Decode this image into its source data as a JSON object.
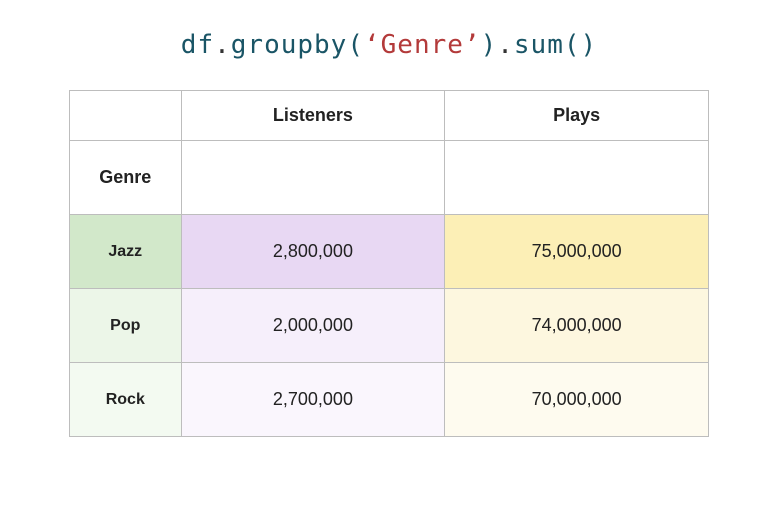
{
  "code": {
    "var": "df",
    "dot1": ".",
    "method1": "groupby",
    "paren_open1": "(",
    "quote_open": "‘",
    "arg": "Genre",
    "quote_close": "’",
    "paren_close1": ")",
    "dot2": ".",
    "method2": "sum",
    "paren_open2": "(",
    "paren_close2": ")"
  },
  "table": {
    "index_name": "Genre",
    "columns": {
      "listeners": "Listeners",
      "plays": "Plays"
    },
    "rows": [
      {
        "genre": "Jazz",
        "listeners": "2,800,000",
        "plays": "75,000,000"
      },
      {
        "genre": "Pop",
        "listeners": "2,000,000",
        "plays": "74,000,000"
      },
      {
        "genre": "Rock",
        "listeners": "2,700,000",
        "plays": "70,000,000"
      }
    ]
  },
  "chart_data": {
    "type": "table",
    "title": "df.groupby('Genre').sum()",
    "columns": [
      "Genre",
      "Listeners",
      "Plays"
    ],
    "rows": [
      {
        "Genre": "Jazz",
        "Listeners": 2800000,
        "Plays": 75000000
      },
      {
        "Genre": "Pop",
        "Listeners": 2000000,
        "Plays": 74000000
      },
      {
        "Genre": "Rock",
        "Listeners": 2700000,
        "Plays": 70000000
      }
    ]
  }
}
